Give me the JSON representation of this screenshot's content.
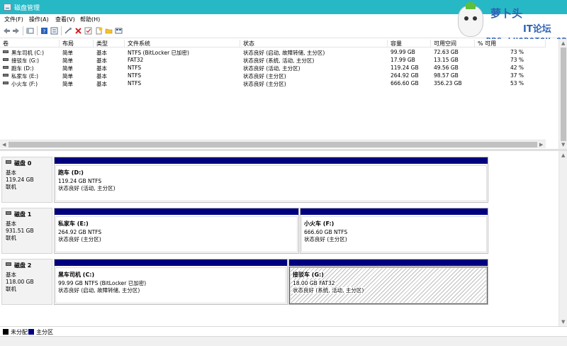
{
  "window": {
    "title": "磁盘管理"
  },
  "menu": {
    "items": [
      "文件(F)",
      "操作(A)",
      "查看(V)",
      "帮助(H)"
    ]
  },
  "toolbar": {
    "icons": [
      "back-arrow-icon",
      "forward-arrow-icon",
      "console-tree-icon",
      "help-icon",
      "properties-icon",
      "connect-icon",
      "delete-icon",
      "check-icon",
      "new-icon",
      "folder-icon",
      "view-icon"
    ]
  },
  "watermark": {
    "line1": "萝卜头",
    "line2": "IT论坛",
    "line3": "BBS.LUOBOTOU.ORG"
  },
  "list": {
    "columns": [
      "卷",
      "布局",
      "类型",
      "文件系统",
      "状态",
      "容量",
      "可用空间",
      "% 可用"
    ],
    "rows": [
      [
        "黑车司机 (C:)",
        "简单",
        "基本",
        "NTFS (BitLocker 已加密)",
        "状态良好 (启动, 故障转储, 主分区)",
        "99.99 GB",
        "72.63 GB",
        "73 %"
      ],
      [
        "接驳车 (G:)",
        "简单",
        "基本",
        "FAT32",
        "状态良好 (系统, 活动, 主分区)",
        "17.99 GB",
        "13.15 GB",
        "73 %"
      ],
      [
        "跑车 (D:)",
        "简单",
        "基本",
        "NTFS",
        "状态良好 (活动, 主分区)",
        "119.24 GB",
        "49.56 GB",
        "42 %"
      ],
      [
        "私家车 (E:)",
        "简单",
        "基本",
        "NTFS",
        "状态良好 (主分区)",
        "264.92 GB",
        "98.57 GB",
        "37 %"
      ],
      [
        "小火车 (F:)",
        "简单",
        "基本",
        "NTFS",
        "状态良好 (主分区)",
        "666.60 GB",
        "356.23 GB",
        "53 %"
      ]
    ]
  },
  "disks": [
    {
      "name": "磁盘 0",
      "type": "基本",
      "size": "119.24 GB",
      "state": "联机",
      "partitions": [
        {
          "title": "跑车  (D:)",
          "size_fs": "119.24 GB NTFS",
          "status": "状态良好 (活动, 主分区)",
          "hatched": false
        }
      ]
    },
    {
      "name": "磁盘 1",
      "type": "基本",
      "size": "931.51 GB",
      "state": "联机",
      "partitions": [
        {
          "title": "私家车  (E:)",
          "size_fs": "264.92 GB NTFS",
          "status": "状态良好 (主分区)",
          "hatched": false
        },
        {
          "title": "小火车  (F:)",
          "size_fs": "666.60 GB NTFS",
          "status": "状态良好 (主分区)",
          "hatched": false
        }
      ]
    },
    {
      "name": "磁盘 2",
      "type": "基本",
      "size": "118.00 GB",
      "state": "联机",
      "partitions": [
        {
          "title": "黑车司机  (C:)",
          "size_fs": "99.99 GB NTFS (BitLocker 已加密)",
          "status": "状态良好 (启动, 故障转储, 主分区)",
          "hatched": false
        },
        {
          "title": "接驳车  (G:)",
          "size_fs": "18.00 GB FAT32",
          "status": "状态良好 (系统, 活动, 主分区)",
          "hatched": true
        }
      ]
    }
  ],
  "legend": {
    "unallocated": "未分配",
    "primary": "主分区",
    "unallocated_color": "#000000",
    "primary_color": "#00007f"
  },
  "colors": {
    "titlebar": "#27b8c6",
    "partition_bar": "#00007f"
  }
}
